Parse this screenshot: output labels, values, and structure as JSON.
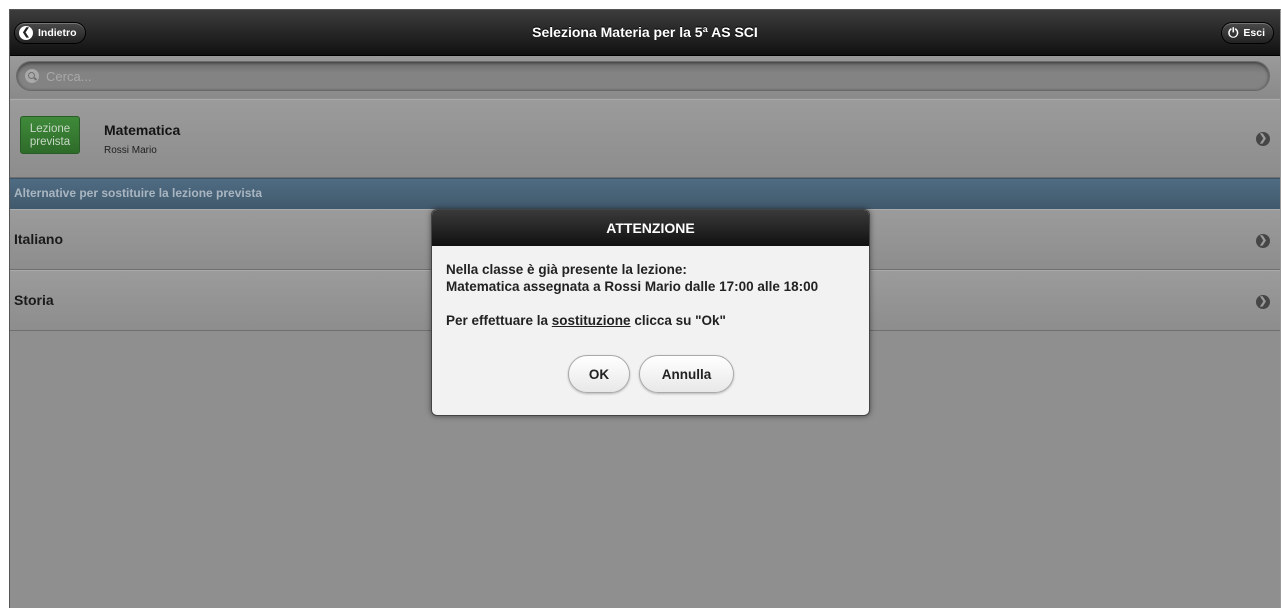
{
  "header": {
    "back_label": "Indietro",
    "back_icon": "chevron-left-icon",
    "title": "Seleziona Materia per la 5ª AS SCI",
    "exit_label": "Esci",
    "exit_icon": "power-icon"
  },
  "search": {
    "placeholder": "Cerca...",
    "icon": "search-icon"
  },
  "main_item": {
    "badge": "Lezione prevista",
    "badge_color": "#3a7d36",
    "title": "Matematica",
    "subtitle": "Rossi Mario"
  },
  "divider": {
    "label": "Alternative per sostituire la lezione prevista",
    "color": "#4a657b"
  },
  "alternatives": [
    {
      "label": "Italiano"
    },
    {
      "label": "Storia"
    }
  ],
  "dialog": {
    "title": "ATTENZIONE",
    "line1": "Nella classe è già presente la lezione:",
    "line2": "Matematica assegnata a Rossi Mario dalle 17:00 alle 18:00",
    "line3_pre": "Per effettuare la ",
    "line3_link": "sostituzione",
    "line3_post": " clicca su \"Ok\"",
    "ok_label": "OK",
    "cancel_label": "Annulla"
  }
}
